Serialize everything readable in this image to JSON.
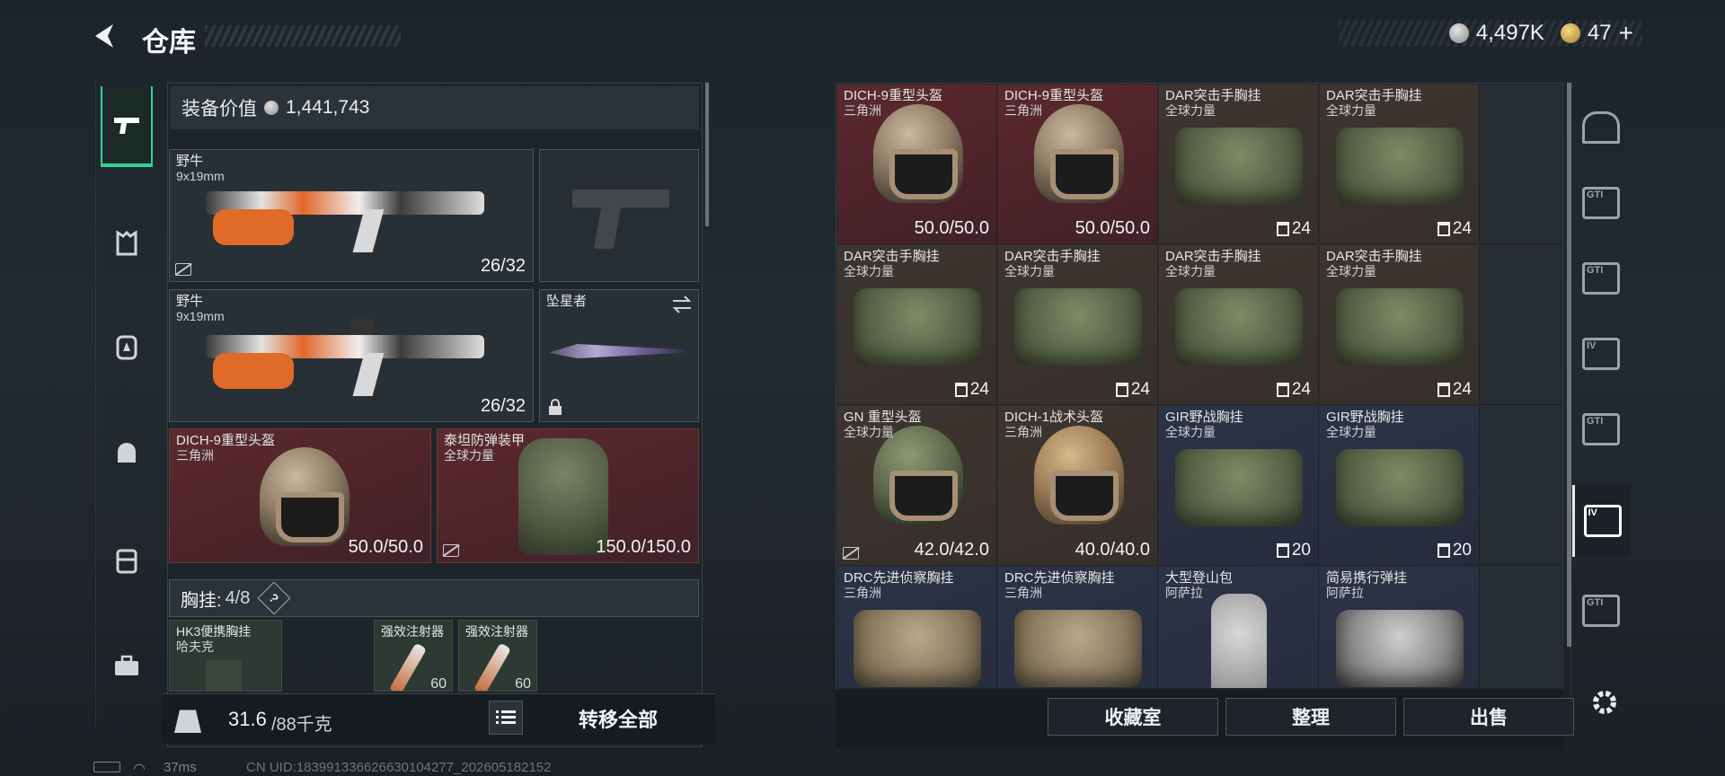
{
  "header": {
    "title": "仓库",
    "currency_value": "4,497K",
    "tickets": "47"
  },
  "left_sidebar": [
    {
      "key": "weapon",
      "icon": "pistol-icon"
    },
    {
      "key": "armor",
      "icon": "armor-icon"
    },
    {
      "key": "backpack",
      "icon": "backpack-icon"
    },
    {
      "key": "helmet",
      "icon": "helmet-gear-icon"
    },
    {
      "key": "bag",
      "icon": "bag-icon"
    },
    {
      "key": "toolbox",
      "icon": "toolbox-icon"
    }
  ],
  "equipment": {
    "value_label": "装备价值",
    "value": "1,441,743",
    "primary1": {
      "name": "野牛",
      "caliber": "9x19mm",
      "ammo": "26/32"
    },
    "primary2": {
      "name": "野牛",
      "caliber": "9x19mm",
      "ammo": "26/32"
    },
    "melee": {
      "name": "坠星者"
    },
    "helmet": {
      "name": "DICH-9重型头盔",
      "origin": "三角洲",
      "durability": "50.0/50.0"
    },
    "armor": {
      "name": "泰坦防弹装甲",
      "origin": "全球力量",
      "durability": "150.0/150.0"
    },
    "rig_label": "胸挂:",
    "rig_value": "4/8",
    "rig_help": "?",
    "rig_items": [
      {
        "name": "HK3便携胸挂",
        "origin": "哈夫克"
      },
      {
        "name": "强效注射器",
        "count": "60"
      },
      {
        "name": "强效注射器",
        "count": "60"
      }
    ]
  },
  "weight": {
    "current": "31.6",
    "max": "/88千克"
  },
  "transfer_all": "转移全部",
  "storage_items": [
    {
      "name": "DICH-9重型头盔",
      "origin": "三角洲",
      "value": "50.0/50.0",
      "type": "helmet",
      "bg": "red"
    },
    {
      "name": "DICH-9重型头盔",
      "origin": "三角洲",
      "value": "50.0/50.0",
      "type": "helmet",
      "bg": "red"
    },
    {
      "name": "DAR突击手胸挂",
      "origin": "全球力量",
      "value": "24",
      "type": "bag",
      "bg": "brown"
    },
    {
      "name": "DAR突击手胸挂",
      "origin": "全球力量",
      "value": "24",
      "type": "bag",
      "bg": "brown"
    },
    {
      "name": "DAR突击手胸挂",
      "origin": "全球力量",
      "value": "24",
      "type": "bag",
      "bg": "brown"
    },
    {
      "name": "DAR突击手胸挂",
      "origin": "全球力量",
      "value": "24",
      "type": "bag",
      "bg": "brown"
    },
    {
      "name": "DAR突击手胸挂",
      "origin": "全球力量",
      "value": "24",
      "type": "bag",
      "bg": "brown"
    },
    {
      "name": "DAR突击手胸挂",
      "origin": "全球力量",
      "value": "24",
      "type": "bag",
      "bg": "brown"
    },
    {
      "name": "GN 重型头盔",
      "origin": "全球力量",
      "value": "42.0/42.0",
      "type": "helmet-green",
      "bg": "brown"
    },
    {
      "name": "DICH-1战术头盔",
      "origin": "三角洲",
      "value": "40.0/40.0",
      "type": "helmet-tan",
      "bg": "brown"
    },
    {
      "name": "GIR野战胸挂",
      "origin": "全球力量",
      "value": "20",
      "type": "bag",
      "bg": "blue"
    },
    {
      "name": "GIR野战胸挂",
      "origin": "全球力量",
      "value": "20",
      "type": "bag",
      "bg": "blue"
    },
    {
      "name": "DRC先进侦察胸挂",
      "origin": "三角洲",
      "value": "",
      "type": "bag-tan",
      "bg": "blue"
    },
    {
      "name": "DRC先进侦察胸挂",
      "origin": "三角洲",
      "value": "",
      "type": "bag-tan",
      "bg": "blue"
    },
    {
      "name": "大型登山包",
      "origin": "阿萨拉",
      "value": "",
      "type": "pack",
      "bg": "blue"
    },
    {
      "name": "简易携行弹挂",
      "origin": "阿萨拉",
      "value": "",
      "type": "bag-grey",
      "bg": "blue"
    }
  ],
  "right_tabs": [
    {
      "label": "",
      "icon": "bunker-icon"
    },
    {
      "label": "GTI",
      "icon": "gti-container-icon"
    },
    {
      "label": "GTI",
      "icon": "gti-container-icon"
    },
    {
      "label": "IV",
      "icon": "iv-container-icon"
    },
    {
      "label": "GTI",
      "icon": "gti-container-icon"
    },
    {
      "label": "IV",
      "icon": "iv-container-icon"
    },
    {
      "label": "GTI",
      "icon": "gti-container-icon"
    }
  ],
  "actions": {
    "collection": "收藏室",
    "sort": "整理",
    "sell": "出售"
  },
  "status": {
    "ping": "37ms",
    "uid": "CN UID:18399133662663010427​7_202605182152"
  }
}
